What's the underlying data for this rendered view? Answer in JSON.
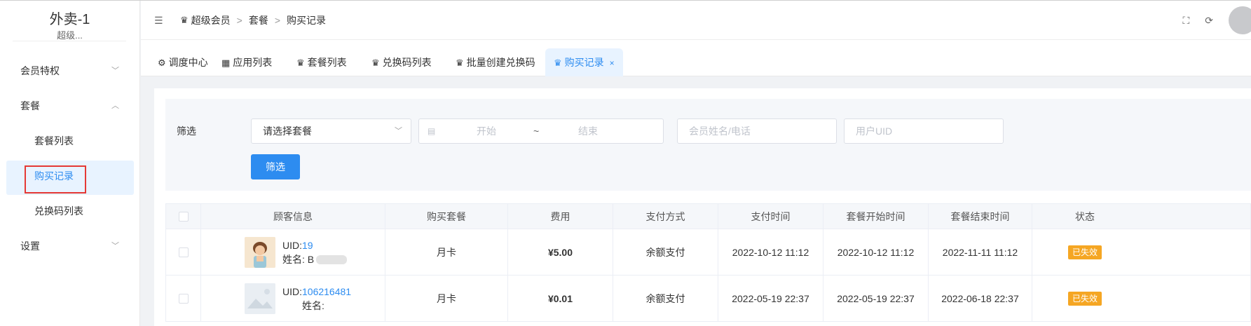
{
  "sidebar": {
    "brand_title": "外卖-1",
    "brand_sub": "超级...",
    "items": [
      {
        "label": "会员特权",
        "expanded": false
      },
      {
        "label": "套餐",
        "expanded": true
      },
      {
        "label": "套餐列表"
      },
      {
        "label": "购买记录",
        "active": true
      },
      {
        "label": "兑换码列表"
      },
      {
        "label": "设置",
        "expanded": false
      }
    ]
  },
  "header": {
    "breadcrumb": [
      "超级会员",
      "套餐",
      "购买记录"
    ],
    "breadcrumb_sep": ">"
  },
  "tabs": [
    {
      "label": "调度中心",
      "icon": "dispatch-icon"
    },
    {
      "label": "应用列表",
      "icon": "apps-icon"
    },
    {
      "label": "套餐列表",
      "icon": "crown-icon"
    },
    {
      "label": "兑换码列表",
      "icon": "crown-icon"
    },
    {
      "label": "批量创建兑换码",
      "icon": "crown-icon"
    },
    {
      "label": "购买记录",
      "icon": "crown-icon",
      "active": true
    }
  ],
  "filter": {
    "label": "筛选",
    "select_placeholder": "请选择套餐",
    "date_start": "开始",
    "date_sep": "~",
    "date_end": "结束",
    "name_placeholder": "会员姓名/电话",
    "uid_placeholder": "用户UID",
    "button": "筛选"
  },
  "table": {
    "columns": [
      "顾客信息",
      "购买套餐",
      "费用",
      "支付方式",
      "支付时间",
      "套餐开始时间",
      "套餐结束时间",
      "状态"
    ],
    "rows": [
      {
        "uid_label": "UID:",
        "uid": "19",
        "name_label": "姓名: B",
        "package": "月卡",
        "fee": "¥5.00",
        "pay_method": "余额支付",
        "pay_time": "2022-10-12 11:12",
        "start_time": "2022-10-12 11:12",
        "end_time": "2022-11-11 11:12",
        "status": "已失效"
      },
      {
        "uid_label": "UID:",
        "uid": "106216481",
        "name_label": "姓名:",
        "package": "月卡",
        "fee": "¥0.01",
        "pay_method": "余额支付",
        "pay_time": "2022-05-19 22:37",
        "start_time": "2022-05-19 22:37",
        "end_time": "2022-06-18 22:37",
        "status": "已失效"
      }
    ]
  },
  "colors": {
    "accent": "#2d8cf0",
    "status_expired": "#f5a623",
    "highlight_box": "#e53935"
  }
}
